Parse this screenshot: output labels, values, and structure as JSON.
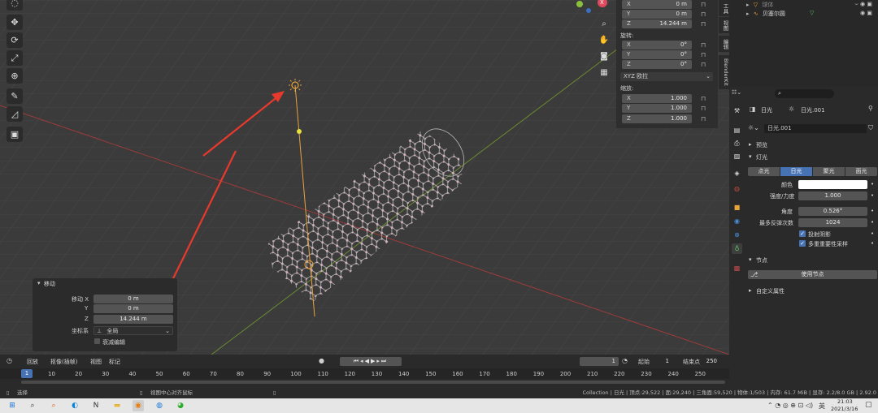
{
  "viewport": {
    "nav_gizmo": {
      "x_label": "X"
    }
  },
  "transform_panel": {
    "location": {
      "x": "0 m",
      "y": "0 m",
      "z": "14.244 m"
    },
    "rotation_label": "旋转:",
    "rotation": {
      "x": "0°",
      "y": "0°",
      "z": "0°"
    },
    "rotation_mode": "XYZ 欧拉",
    "scale_label": "缩放:",
    "scale": {
      "x": "1.000",
      "y": "1.000",
      "z": "1.000"
    },
    "axis_x": "X",
    "axis_y": "Y",
    "axis_z": "Z"
  },
  "side_tabs": [
    "工具",
    "视图",
    "编辑",
    "BlenderKit"
  ],
  "outliner": {
    "items": [
      {
        "label": "球体"
      },
      {
        "label": "贝塞尔圆"
      }
    ]
  },
  "operator_panel": {
    "title": "移动",
    "move_x_label": "移动 X",
    "y_label": "Y",
    "z_label": "Z",
    "x": "0 m",
    "y": "0 m",
    "z": "14.244 m",
    "orientation_label": "坐标系",
    "orientation_value": "全局",
    "proportional_label": "衰减编辑"
  },
  "timeline": {
    "menus": [
      "回放",
      "抠像(插帧)",
      "视图",
      "标记"
    ],
    "current_frame": "1",
    "start_label": "起始",
    "start": "1",
    "end_label": "结束点",
    "end": "250",
    "ticks": [
      "1",
      "10",
      "20",
      "30",
      "40",
      "50",
      "60",
      "70",
      "80",
      "90",
      "100",
      "110",
      "120",
      "130",
      "140",
      "150",
      "160",
      "170",
      "180",
      "190",
      "200",
      "210",
      "220",
      "230",
      "240",
      "250"
    ]
  },
  "properties": {
    "search_placeholder": "",
    "breadcrumb_obj": "日光",
    "breadcrumb_data": "日光.001",
    "datablock_name": "日光.001",
    "preview_label": "预览",
    "light_section": "灯光",
    "light_types": [
      "点光",
      "日光",
      "聚光",
      "面光"
    ],
    "active_light_type": "日光",
    "color_label": "颜色",
    "strength_label": "强度/力度",
    "strength": "1.000",
    "angle_label": "角度",
    "angle": "0.526°",
    "max_bounces_label": "最多反弹次数",
    "max_bounces": "1024",
    "cast_shadow": "投射阴影",
    "mis": "多重重要性采样",
    "nodes_section": "节点",
    "use_nodes": "使用节点",
    "custom_props": "自定义属性"
  },
  "statusbar": {
    "left": "选择",
    "mid": "视图中心对齐鼠标",
    "right": "Collection | 日光 | 顶点:29,522 | 面:29,240 | 三角面:59,520 | 物体:1/503 | 内存: 61.7 MiB | 显存: 2.2/8.0 GB | 2.92.0"
  },
  "taskbar": {
    "time": "21:03",
    "date": "2021/3/16",
    "ime": "英"
  },
  "colors": {
    "accent": "#4772b3",
    "annotation_arrow": "#e8392c",
    "light_line": "#e8a33d"
  }
}
